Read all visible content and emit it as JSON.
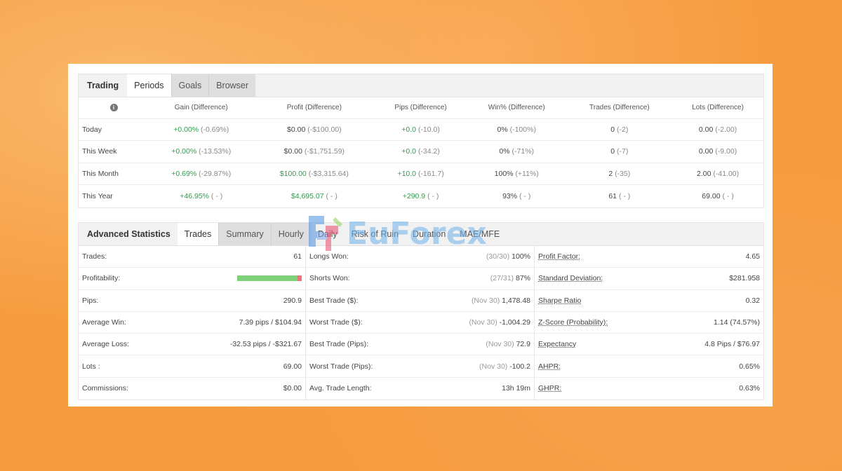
{
  "periods": {
    "tabs": [
      "Trading",
      "Periods",
      "Goals",
      "Browser"
    ],
    "headers": [
      "Gain (Difference)",
      "Profit (Difference)",
      "Pips (Difference)",
      "Win% (Difference)",
      "Trades (Difference)",
      "Lots (Difference)"
    ],
    "rows": [
      {
        "label": "Today",
        "cells": [
          [
            "+0.00%",
            "(-0.69%)",
            "pos"
          ],
          [
            "$0.00",
            "(-$100.00)",
            ""
          ],
          [
            "+0.0",
            "(-10.0)",
            "pos"
          ],
          [
            "0%",
            "(-100%)",
            ""
          ],
          [
            "0",
            "(-2)",
            ""
          ],
          [
            "0.00",
            "(-2.00)",
            ""
          ]
        ]
      },
      {
        "label": "This Week",
        "cells": [
          [
            "+0.00%",
            "(-13.53%)",
            "pos"
          ],
          [
            "$0.00",
            "(-$1,751.59)",
            ""
          ],
          [
            "+0.0",
            "(-34.2)",
            "pos"
          ],
          [
            "0%",
            "(-71%)",
            ""
          ],
          [
            "0",
            "(-7)",
            ""
          ],
          [
            "0.00",
            "(-9.00)",
            ""
          ]
        ]
      },
      {
        "label": "This Month",
        "cells": [
          [
            "+0.69%",
            "(-29.87%)",
            "pos"
          ],
          [
            "$100.00",
            "(-$3,315.64)",
            "pos"
          ],
          [
            "+10.0",
            "(-161.7)",
            "pos"
          ],
          [
            "100%",
            "(+11%)",
            ""
          ],
          [
            "2",
            "(-35)",
            ""
          ],
          [
            "2.00",
            "(-41.00)",
            ""
          ]
        ]
      },
      {
        "label": "This Year",
        "cells": [
          [
            "+46.95%",
            "( - )",
            "pos"
          ],
          [
            "$4,695.07",
            "( - )",
            "pos"
          ],
          [
            "+290.9",
            "( - )",
            "pos"
          ],
          [
            "93%",
            "( - )",
            ""
          ],
          [
            "61",
            "( - )",
            ""
          ],
          [
            "69.00",
            "( - )",
            ""
          ]
        ]
      }
    ]
  },
  "advanced": {
    "title": "Advanced Statistics",
    "tabs": [
      "Trades",
      "Summary",
      "Hourly",
      "Daily",
      "Risk of Ruin",
      "Duration",
      "MAE/MFE"
    ],
    "col1": [
      {
        "k": "Trades:",
        "v": "61"
      },
      {
        "k": "Profitability:",
        "bar": true
      },
      {
        "k": "Pips:",
        "v": "290.9"
      },
      {
        "k": "Average Win:",
        "v": "7.39 pips / $104.94"
      },
      {
        "k": "Average Loss:",
        "v": "-32.53 pips / -$321.67"
      },
      {
        "k": "Lots :",
        "v": "69.00"
      },
      {
        "k": "Commissions:",
        "v": "$0.00"
      }
    ],
    "col2": [
      {
        "k": "Longs Won:",
        "sub": "(30/30)",
        "v": "100%"
      },
      {
        "k": "Shorts Won:",
        "sub": "(27/31)",
        "v": "87%"
      },
      {
        "k": "Best Trade ($):",
        "sub": "(Nov 30)",
        "v": "1,478.48"
      },
      {
        "k": "Worst Trade ($):",
        "sub": "(Nov 30)",
        "v": "-1,004.29"
      },
      {
        "k": "Best Trade (Pips):",
        "sub": "(Nov 30)",
        "v": "72.9"
      },
      {
        "k": "Worst Trade (Pips):",
        "sub": "(Nov 30)",
        "v": "-100.2"
      },
      {
        "k": "Avg. Trade Length:",
        "sub": "",
        "v": "13h 19m"
      }
    ],
    "col3": [
      {
        "k": "Profit Factor:",
        "v": "4.65"
      },
      {
        "k": "Standard Deviation:",
        "v": "$281.958"
      },
      {
        "k": "Sharpe Ratio",
        "v": "0.32"
      },
      {
        "k": "Z-Score (Probability):",
        "v": "1.14 (74.57%)"
      },
      {
        "k": "Expectancy",
        "v": "4.8 Pips / $76.97"
      },
      {
        "k": "AHPR:",
        "v": "0.65%"
      },
      {
        "k": "GHPR:",
        "v": "0.63%"
      }
    ],
    "profitability_fraction": 0.93
  },
  "watermark": {
    "text": "EuForex"
  },
  "colors": {
    "positive": "#2e9e4a",
    "bar_good": "#7ed07a",
    "bar_bad": "#e8777a",
    "background": "#f59b3e"
  }
}
